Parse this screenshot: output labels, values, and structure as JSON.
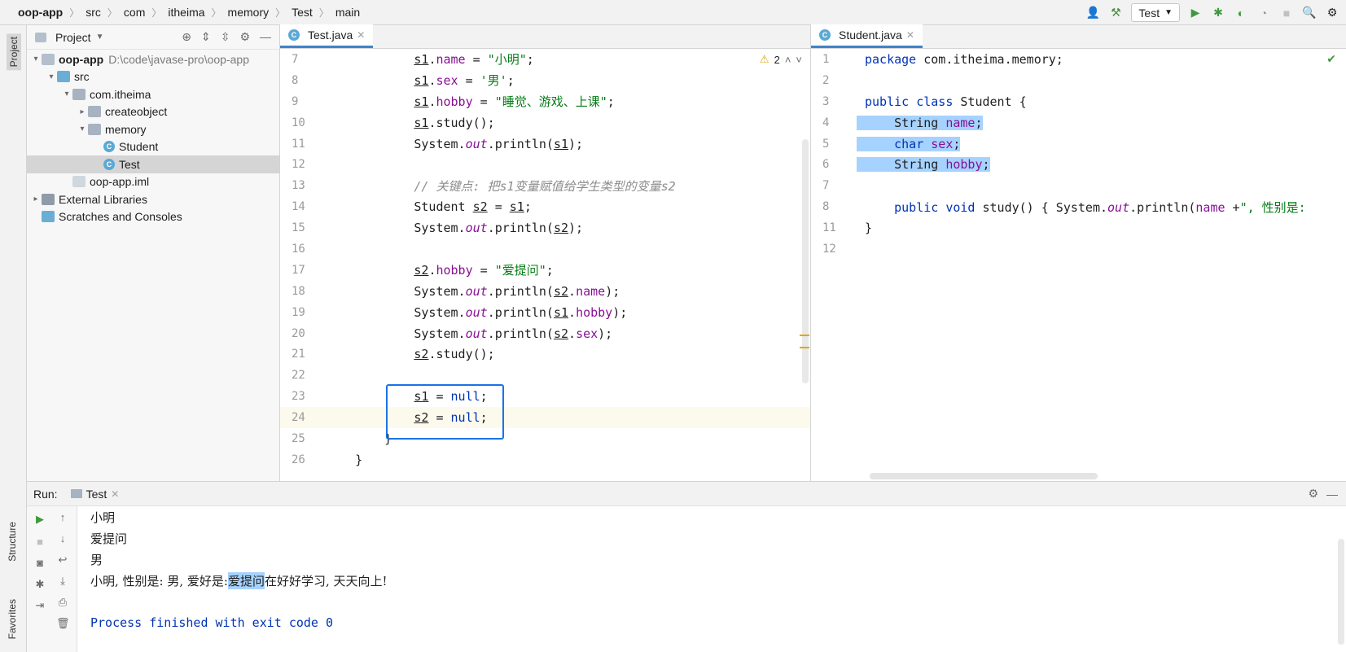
{
  "breadcrumb": [
    "oop-app",
    "src",
    "com",
    "itheima",
    "memory",
    "Test",
    "main"
  ],
  "toolbar": {
    "run_config": "Test"
  },
  "left_strip": {
    "top": "Project",
    "structure": "Structure",
    "favorites": "Favorites"
  },
  "project": {
    "title": "Project",
    "tree": [
      {
        "label": "oop-app",
        "extra": "D:\\code\\javase-pro\\oop-app",
        "depth": 0,
        "arrow": "▾",
        "icon": "folder"
      },
      {
        "label": "src",
        "depth": 1,
        "arrow": "▾",
        "icon": "srcf"
      },
      {
        "label": "com.itheima",
        "depth": 2,
        "arrow": "▾",
        "icon": "pkg"
      },
      {
        "label": "createobject",
        "depth": 3,
        "arrow": "▸",
        "icon": "pkg"
      },
      {
        "label": "memory",
        "depth": 3,
        "arrow": "▾",
        "icon": "pkg"
      },
      {
        "label": "Student",
        "depth": 4,
        "arrow": "",
        "icon": "cls"
      },
      {
        "label": "Test",
        "depth": 4,
        "arrow": "",
        "icon": "cls",
        "selected": true
      },
      {
        "label": "oop-app.iml",
        "depth": 2,
        "arrow": "",
        "icon": "file"
      },
      {
        "label": "External Libraries",
        "depth": 0,
        "arrow": "▸",
        "icon": "lib"
      },
      {
        "label": "Scratches and Consoles",
        "depth": 0,
        "arrow": "",
        "icon": "srcf"
      }
    ]
  },
  "editor1": {
    "tab": "Test.java",
    "warnings": "2",
    "lines": [
      {
        "n": "7",
        "segs": [
          [
            "",
            "            "
          ],
          [
            "ul",
            "s1"
          ],
          [
            "",
            ".",
            ""
          ],
          [
            "fld",
            "name"
          ],
          [
            "",
            " = "
          ],
          [
            "str",
            "\"小明\""
          ],
          [
            "",
            ";"
          ]
        ]
      },
      {
        "n": "8",
        "segs": [
          [
            "",
            "            "
          ],
          [
            "ul",
            "s1"
          ],
          [
            "",
            "."
          ],
          [
            "fld",
            "sex"
          ],
          [
            "",
            " = "
          ],
          [
            "str",
            "'男'"
          ],
          [
            "",
            ";"
          ]
        ]
      },
      {
        "n": "9",
        "segs": [
          [
            "",
            "            "
          ],
          [
            "ul",
            "s1"
          ],
          [
            "",
            "."
          ],
          [
            "fld",
            "hobby"
          ],
          [
            "",
            " = "
          ],
          [
            "str",
            "\"睡觉、游戏、上课\""
          ],
          [
            "",
            ";"
          ]
        ]
      },
      {
        "n": "10",
        "segs": [
          [
            "",
            "            "
          ],
          [
            "ul",
            "s1"
          ],
          [
            "",
            ".study();"
          ]
        ]
      },
      {
        "n": "11",
        "segs": [
          [
            "",
            "            System."
          ],
          [
            "it",
            "out"
          ],
          [
            "",
            ".println("
          ],
          [
            "ul",
            "s1"
          ],
          [
            "",
            ");"
          ]
        ]
      },
      {
        "n": "12",
        "segs": [
          [
            "",
            ""
          ]
        ]
      },
      {
        "n": "13",
        "segs": [
          [
            "",
            "            "
          ],
          [
            "cmt",
            "// 关键点: 把s1变量赋值给学生类型的变量s2"
          ]
        ]
      },
      {
        "n": "14",
        "segs": [
          [
            "",
            "            Student "
          ],
          [
            "ul",
            "s2"
          ],
          [
            "",
            " = "
          ],
          [
            "ul",
            "s1"
          ],
          [
            "",
            ";"
          ]
        ]
      },
      {
        "n": "15",
        "segs": [
          [
            "",
            "            System."
          ],
          [
            "it",
            "out"
          ],
          [
            "",
            ".println("
          ],
          [
            "ul",
            "s2"
          ],
          [
            "",
            ");"
          ]
        ]
      },
      {
        "n": "16",
        "segs": [
          [
            "",
            ""
          ]
        ]
      },
      {
        "n": "17",
        "segs": [
          [
            "",
            "            "
          ],
          [
            "ul",
            "s2"
          ],
          [
            "",
            "."
          ],
          [
            "fld",
            "hobby"
          ],
          [
            "",
            " = "
          ],
          [
            "str",
            "\"爱提问\""
          ],
          [
            "",
            ";"
          ]
        ]
      },
      {
        "n": "18",
        "segs": [
          [
            "",
            "            System."
          ],
          [
            "it",
            "out"
          ],
          [
            "",
            ".println("
          ],
          [
            "ul",
            "s2"
          ],
          [
            "",
            "."
          ],
          [
            "fld",
            "name"
          ],
          [
            "",
            ");"
          ]
        ]
      },
      {
        "n": "19",
        "segs": [
          [
            "",
            "            System."
          ],
          [
            "it",
            "out"
          ],
          [
            "",
            ".println("
          ],
          [
            "ul",
            "s1"
          ],
          [
            "",
            "."
          ],
          [
            "fld",
            "hobby"
          ],
          [
            "",
            ");"
          ]
        ]
      },
      {
        "n": "20",
        "segs": [
          [
            "",
            "            System."
          ],
          [
            "it",
            "out"
          ],
          [
            "",
            ".println("
          ],
          [
            "ul",
            "s2"
          ],
          [
            "",
            "."
          ],
          [
            "fld",
            "sex"
          ],
          [
            "",
            ");"
          ]
        ]
      },
      {
        "n": "21",
        "segs": [
          [
            "",
            "            "
          ],
          [
            "ul",
            "s2"
          ],
          [
            "",
            ".study();"
          ]
        ]
      },
      {
        "n": "22",
        "segs": [
          [
            "",
            ""
          ]
        ]
      },
      {
        "n": "23",
        "segs": [
          [
            "",
            "            "
          ],
          [
            "ul",
            "s1"
          ],
          [
            "",
            " = "
          ],
          [
            "kw",
            "null"
          ],
          [
            "",
            ";"
          ]
        ]
      },
      {
        "n": "24",
        "segs": [
          [
            "",
            "            "
          ],
          [
            "ul",
            "s2"
          ],
          [
            "",
            " = "
          ],
          [
            "kw",
            "null"
          ],
          [
            "",
            ";"
          ]
        ]
      },
      {
        "n": "25",
        "segs": [
          [
            "",
            "        }"
          ]
        ]
      },
      {
        "n": "26",
        "segs": [
          [
            "",
            "    }"
          ]
        ]
      }
    ]
  },
  "editor2": {
    "tab": "Student.java",
    "lines": [
      {
        "n": "1",
        "segs": [
          [
            "kw",
            "package"
          ],
          [
            "",
            " com.itheima.memory;"
          ]
        ]
      },
      {
        "n": "2",
        "segs": [
          [
            "",
            ""
          ]
        ]
      },
      {
        "n": "3",
        "segs": [
          [
            "kw",
            "public class"
          ],
          [
            "",
            " Student {"
          ]
        ]
      },
      {
        "n": "4",
        "segs": [
          [
            "",
            "    String "
          ],
          [
            "fld",
            "name"
          ],
          [
            "",
            ";"
          ]
        ]
      },
      {
        "n": "5",
        "segs": [
          [
            "",
            "    "
          ],
          [
            "kw",
            "char"
          ],
          [
            "",
            " "
          ],
          [
            "fld",
            "sex"
          ],
          [
            "",
            ";"
          ]
        ]
      },
      {
        "n": "6",
        "segs": [
          [
            "",
            "    String "
          ],
          [
            "fld",
            "hobby"
          ],
          [
            "",
            ";"
          ]
        ]
      },
      {
        "n": "7",
        "segs": [
          [
            "",
            ""
          ]
        ]
      },
      {
        "n": "8",
        "segs": [
          [
            "",
            "    "
          ],
          [
            "kw",
            "public void"
          ],
          [
            "",
            " study() { System."
          ],
          [
            "it",
            "out"
          ],
          [
            "",
            ".println("
          ],
          [
            "fld",
            "name"
          ],
          [
            "",
            " +"
          ],
          [
            "str",
            "\", 性别是: "
          ]
        ]
      },
      {
        "n": "11",
        "segs": [
          [
            "",
            "}"
          ]
        ]
      },
      {
        "n": "12",
        "segs": [
          [
            "",
            ""
          ]
        ]
      }
    ]
  },
  "run": {
    "label": "Run:",
    "tab": "Test",
    "output": [
      "小明",
      "爱提问",
      "男"
    ],
    "output_last_pre": "小明, 性别是: 男, 爱好是: ",
    "output_last_hl": "爱提问",
    "output_last_post": "在好好学习, 天天向上!",
    "process": "Process finished with exit code 0"
  }
}
